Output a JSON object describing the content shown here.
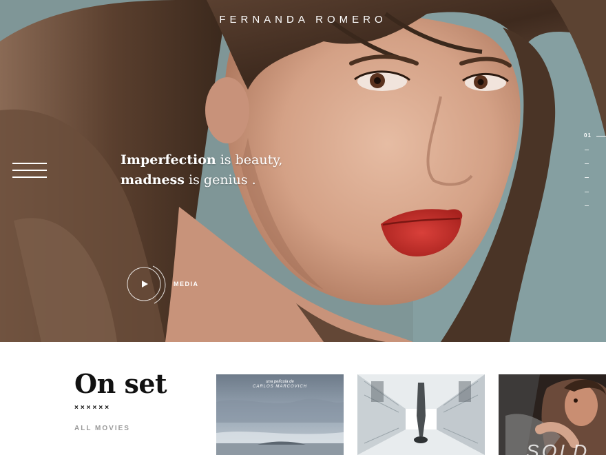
{
  "header": {
    "brand": "FERNANDA ROMERO",
    "menu_icon": "hamburger-icon"
  },
  "hero": {
    "tagline_line1_bold": "Imperfection",
    "tagline_line1_rest": " is beauty,",
    "tagline_line2_bold": "madness",
    "tagline_line2_rest": " is genius .",
    "media_label": "MEDIA",
    "media_icon": "play-icon",
    "slide_number": "01",
    "colors": {
      "backdrop": "#7f9697",
      "hair": "#4a3426",
      "skin": "#d9ab92",
      "lips": "#c9302a"
    }
  },
  "on_set": {
    "title": "On set",
    "rating": "××××××",
    "all_movies_label": "ALL MOVIES",
    "movies": [
      {
        "caption_small": "una película de",
        "caption_name": "CARLOS MARCOVICH"
      },
      {
        "caption_small": "",
        "caption_name": ""
      },
      {
        "caption_small": "",
        "caption_name": "SOLD"
      }
    ]
  }
}
